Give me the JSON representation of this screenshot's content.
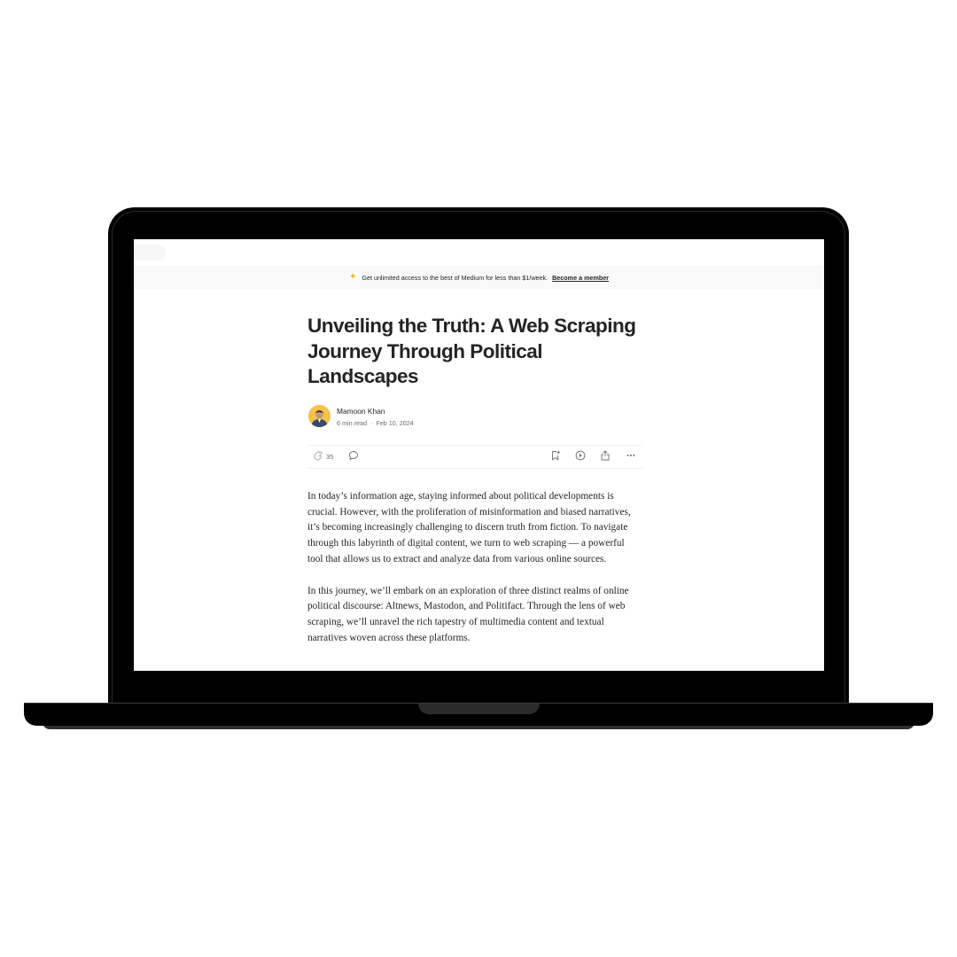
{
  "banner": {
    "text": "Get unlimited access to the best of Medium for less than $1/week.",
    "cta": "Become a member"
  },
  "article": {
    "title": "Unveiling the Truth: A Web Scraping Journey Through Political Landscapes",
    "author": "Mamoon Khan",
    "read_time": "6 min read",
    "separator": "·",
    "date": "Feb 10, 2024",
    "claps": "35",
    "paragraphs": [
      "In today’s information age, staying informed about political developments is crucial. However, with the proliferation of misinformation and biased narratives, it’s becoming increasingly challenging to discern truth from fiction. To navigate through this labyrinth of digital content, we turn to web scraping — a powerful tool that allows us to extract and analyze data from various online sources.",
      "In this journey, we’ll embark on an exploration of three distinct realms of online political discourse: Altnews, Mastodon, and Politifact. Through the lens of web scraping, we’ll unravel the rich tapestry of multimedia content and textual narratives woven across these platforms."
    ]
  },
  "icons": {
    "banner": "sparkle-icon",
    "clap": "clap-icon",
    "comment": "comment-icon",
    "save": "bookmark-add-icon",
    "listen": "play-circle-icon",
    "share": "share-icon",
    "more": "more-icon"
  },
  "colors": {
    "text": "#242424",
    "muted": "#6b6b6b",
    "banner_bg": "#f9f9f9",
    "star": "#f2b705",
    "avatar_bg": "#f3c247"
  }
}
